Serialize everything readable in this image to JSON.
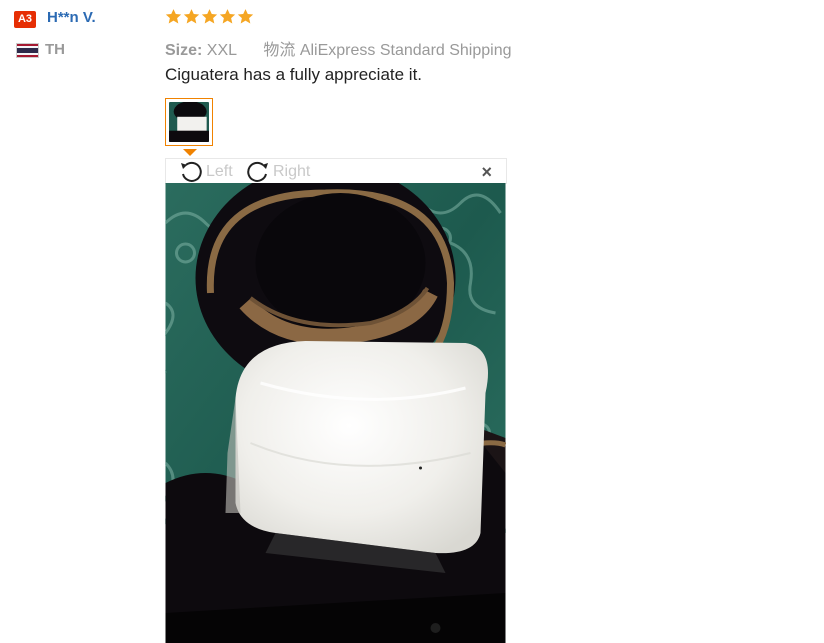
{
  "user": {
    "level_badge": "A3",
    "name": "H**n V.",
    "country": "TH",
    "flag_icon": "thailand-flag-icon"
  },
  "review": {
    "rating": 5,
    "rating_max": 5,
    "star_color": "#f5a623",
    "size_label": "Size:",
    "size_value": "XXL",
    "shipping_label": "物流",
    "shipping_value": "AliExpress Standard Shipping",
    "comment": "Ciguatera has a fully appreciate it."
  },
  "viewer": {
    "rotate_left_label": "Left",
    "rotate_right_label": "Right",
    "close_label": "×"
  },
  "colors": {
    "accent": "#f08200",
    "badge": "#e62e04",
    "name_link": "#2b6ab3",
    "muted": "#999999"
  }
}
